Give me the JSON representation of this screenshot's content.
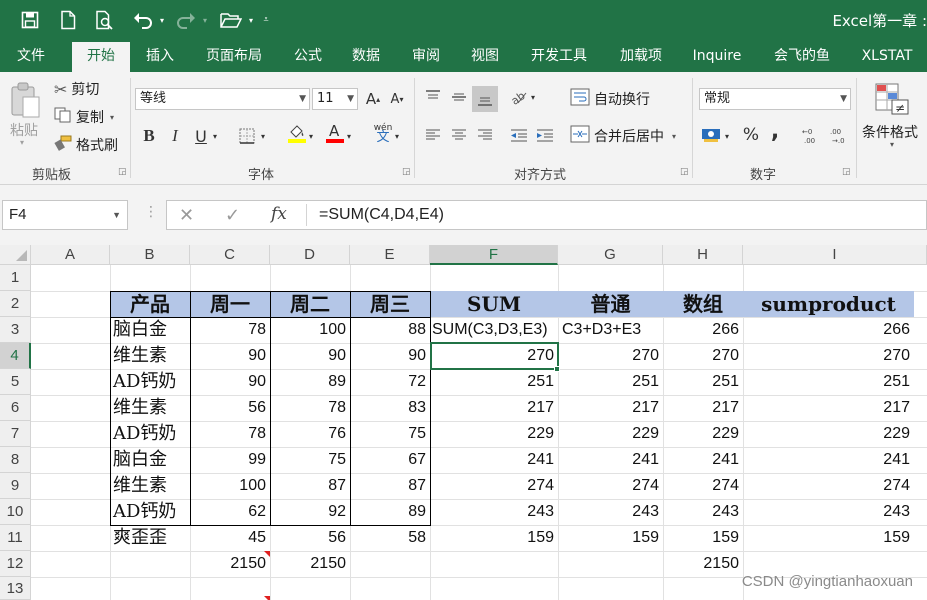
{
  "title_bar": {
    "title": "Excel第一章 :"
  },
  "tabs": [
    "文件",
    "开始",
    "插入",
    "页面布局",
    "公式",
    "数据",
    "审阅",
    "视图",
    "开发工具",
    "加载项",
    "Inquire",
    "会飞的鱼",
    "XLSTAT"
  ],
  "active_tab": "开始",
  "ribbon": {
    "clipboard": {
      "paste": "粘贴",
      "cut": "剪切",
      "copy": "复制",
      "format_painter": "格式刷",
      "label": "剪贴板"
    },
    "font": {
      "font_name": "等线",
      "font_size": "11",
      "bold": "B",
      "italic": "I",
      "underline": "U",
      "phonetic": "wén",
      "label": "字体"
    },
    "alignment": {
      "wrap_text": "自动换行",
      "merge_center": "合并后居中",
      "label": "对齐方式"
    },
    "number": {
      "format": "常规",
      "percent": "%",
      "comma": ",",
      "label": "数字"
    },
    "styles": {
      "conditional_format": "条件格式"
    }
  },
  "formula_bar": {
    "name_box": "F4",
    "formula": "=SUM(C4,D4,E4)",
    "fx": "fx"
  },
  "columns": [
    "A",
    "B",
    "C",
    "D",
    "E",
    "F",
    "G",
    "H",
    "I"
  ],
  "selected_column": "F",
  "rows": [
    "1",
    "2",
    "3",
    "4",
    "5",
    "6",
    "7",
    "8",
    "9",
    "10",
    "11",
    "12",
    "13"
  ],
  "selected_row": "4",
  "table_header": [
    "产品",
    "周一",
    "周二",
    "周三",
    "SUM",
    "普通",
    "数组",
    "sumproduct"
  ],
  "table_rows": [
    {
      "product": "脑白金",
      "mon": "78",
      "tue": "100",
      "wed": "88",
      "sum": "SUM(C3,D3,E3)",
      "normal": "C3+D3+E3",
      "array": "266",
      "sumproduct": "266"
    },
    {
      "product": "维生素",
      "mon": "90",
      "tue": "90",
      "wed": "90",
      "sum": "270",
      "normal": "270",
      "array": "270",
      "sumproduct": "270"
    },
    {
      "product": "AD钙奶",
      "mon": "90",
      "tue": "89",
      "wed": "72",
      "sum": "251",
      "normal": "251",
      "array": "251",
      "sumproduct": "251"
    },
    {
      "product": "维生素",
      "mon": "56",
      "tue": "78",
      "wed": "83",
      "sum": "217",
      "normal": "217",
      "array": "217",
      "sumproduct": "217"
    },
    {
      "product": "AD钙奶",
      "mon": "78",
      "tue": "76",
      "wed": "75",
      "sum": "229",
      "normal": "229",
      "array": "229",
      "sumproduct": "229"
    },
    {
      "product": "脑白金",
      "mon": "99",
      "tue": "75",
      "wed": "67",
      "sum": "241",
      "normal": "241",
      "array": "241",
      "sumproduct": "241"
    },
    {
      "product": "维生素",
      "mon": "100",
      "tue": "87",
      "wed": "87",
      "sum": "274",
      "normal": "274",
      "array": "274",
      "sumproduct": "274"
    },
    {
      "product": "AD钙奶",
      "mon": "62",
      "tue": "92",
      "wed": "89",
      "sum": "243",
      "normal": "243",
      "array": "243",
      "sumproduct": "243"
    },
    {
      "product": "爽歪歪",
      "mon": "45",
      "tue": "56",
      "wed": "58",
      "sum": "159",
      "normal": "159",
      "array": "159",
      "sumproduct": "159"
    }
  ],
  "totals_row": {
    "mon": "2150",
    "tue": "2150",
    "array": "2150"
  },
  "watermark": "CSDN @yingtianhaoxuan",
  "colors": {
    "excel_green": "#217346",
    "header_fill": "#b4c6e7",
    "comment_marker": "#e02020"
  }
}
